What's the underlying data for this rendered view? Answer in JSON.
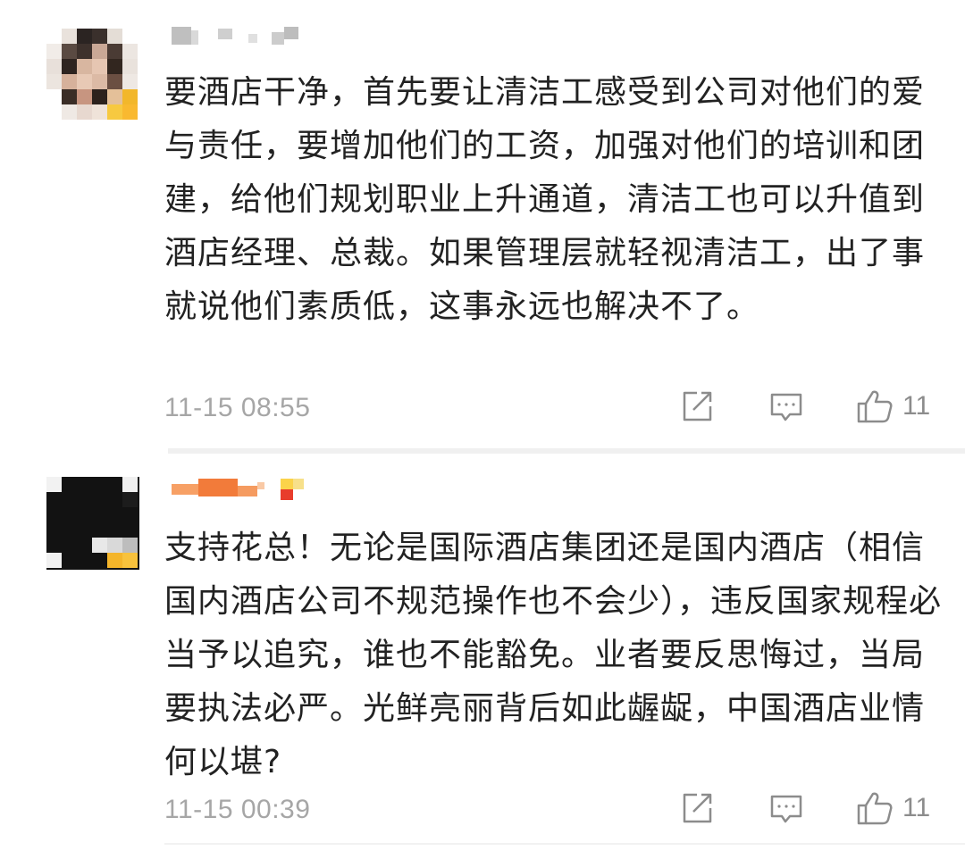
{
  "comments": [
    {
      "text": "要酒店干净，首先要让清洁工感受到公司对他们的爱与责任，要增加他们的工资，加强对他们的培训和团建，给他们规划职业上升通道，清洁工也可以升值到酒店经理、总裁。如果管理层就轻视清洁工，出了事就说他们素质低，这事永远也解决不了。",
      "timestamp": "11-15 08:55",
      "likes": "11",
      "icons": {
        "share": "share-icon",
        "reply": "comment-icon",
        "like": "thumbs-up-icon"
      }
    },
    {
      "text": "支持花总！无论是国际酒店集团还是国内酒店（相信国内酒店公司不规范操作也不会少），违反国家规程必当予以追究，谁也不能豁免。业者要反思悔过，当局要执法必严。光鲜亮丽背后如此龌龊，中国酒店业情何以堪?",
      "timestamp": "11-15 00:39",
      "likes": "11",
      "icons": {
        "share": "share-icon",
        "reply": "comment-icon",
        "like": "thumbs-up-icon"
      }
    }
  ],
  "colors": {
    "text": "#222222",
    "meta": "#a6a6a6",
    "icon": "#8c8c8c",
    "divider": "#f0f0f0"
  }
}
